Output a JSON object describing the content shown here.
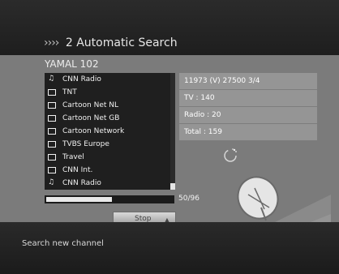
{
  "header": {
    "title": "2 Automatic Search",
    "arrows": "››››"
  },
  "device": {
    "name": "YAMAL 102"
  },
  "channels": [
    {
      "type": "radio",
      "name": "CNN Radio"
    },
    {
      "type": "tv",
      "name": "TNT"
    },
    {
      "type": "tv",
      "name": "Cartoon Net NL"
    },
    {
      "type": "tv",
      "name": "Cartoon Net GB"
    },
    {
      "type": "tv",
      "name": "Cartoon Network"
    },
    {
      "type": "tv",
      "name": "TVBS Europe"
    },
    {
      "type": "tv",
      "name": "Travel"
    },
    {
      "type": "tv",
      "name": "CNN Int."
    },
    {
      "type": "radio",
      "name": "CNN Radio"
    }
  ],
  "info": {
    "transponder": "11973 (V) 27500 3/4",
    "tv": "TV : 140",
    "radio": "Radio : 20",
    "total": "Total : 159"
  },
  "progress": {
    "current": 50,
    "total": 96,
    "text": "50/96"
  },
  "buttons": {
    "stop": "Stop"
  },
  "footer": {
    "hint": "Search new channel"
  },
  "colors": {
    "background": "#7b7b7b",
    "header": "#2b2b2b",
    "panel": "#1f1f1f",
    "info_row": "#959595"
  },
  "icons": {
    "tv": "tv-icon",
    "radio": "radio-icon",
    "spinner": "loading-icon",
    "decoration": "satellite-dish-illustration"
  }
}
